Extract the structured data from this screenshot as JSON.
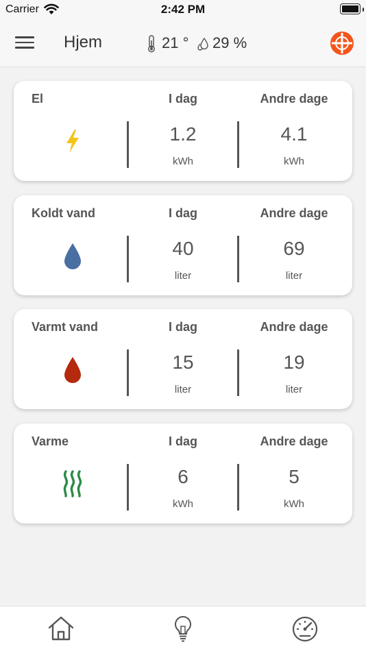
{
  "status_bar": {
    "carrier": "Carrier",
    "time": "2:42 PM"
  },
  "header": {
    "title": "Hjem",
    "temperature": "21 °",
    "humidity": "29 %",
    "accent_color": "#f4551b"
  },
  "cards": [
    {
      "title": "El",
      "today_label": "I dag",
      "other_label": "Andre dage",
      "today_value": "1.2",
      "other_value": "4.1",
      "today_unit": "kWh",
      "other_unit": "kWh",
      "icon": "lightning-icon",
      "icon_color": "#f2c51c"
    },
    {
      "title": "Koldt vand",
      "today_label": "I dag",
      "other_label": "Andre dage",
      "today_value": "40",
      "other_value": "69",
      "today_unit": "liter",
      "other_unit": "liter",
      "icon": "cold-water-drop-icon",
      "icon_color": "#4a6fa3"
    },
    {
      "title": "Varmt vand",
      "today_label": "I dag",
      "other_label": "Andre dage",
      "today_value": "15",
      "other_value": "19",
      "today_unit": "liter",
      "other_unit": "liter",
      "icon": "hot-water-drop-icon",
      "icon_color": "#b5290f"
    },
    {
      "title": "Varme",
      "today_label": "I dag",
      "other_label": "Andre dage",
      "today_value": "6",
      "other_value": "5",
      "today_unit": "kWh",
      "other_unit": "kWh",
      "icon": "heat-waves-icon",
      "icon_color": "#2a8a46"
    }
  ],
  "bottom_nav": {
    "items": [
      {
        "icon": "home-icon"
      },
      {
        "icon": "lightbulb-icon"
      },
      {
        "icon": "gauge-icon"
      }
    ]
  }
}
